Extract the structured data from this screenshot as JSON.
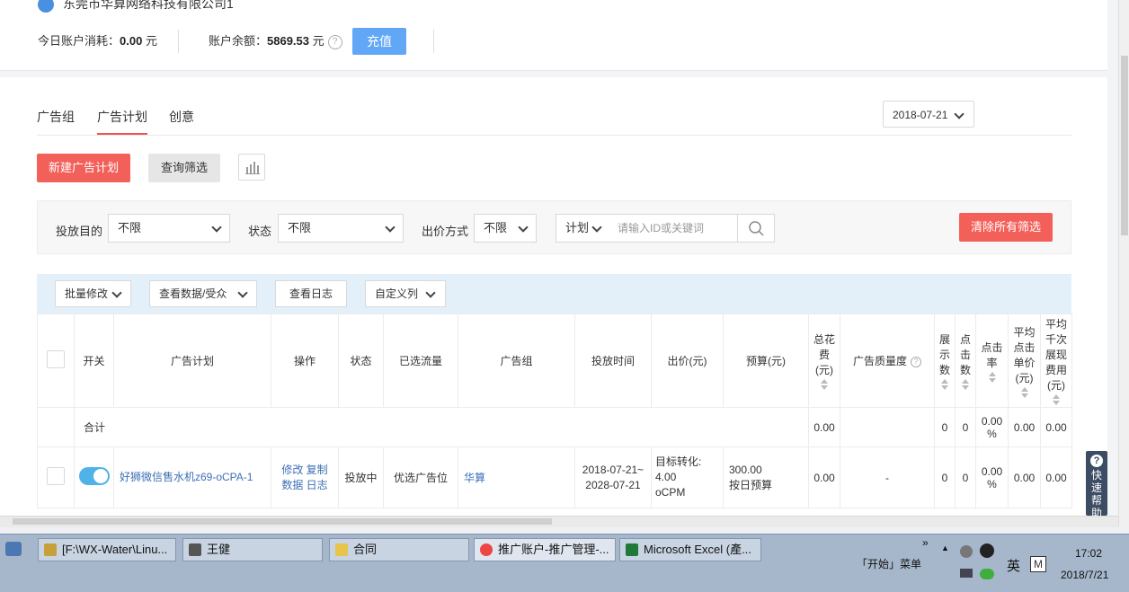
{
  "header": {
    "company": "东莞市华算网络科技有限公司1",
    "today_spend_label": "今日账户消耗：",
    "today_spend_value": "0.00",
    "currency": "元",
    "balance_label": "账户余额：",
    "balance_value": "5869.53",
    "help": "?",
    "recharge": "充值"
  },
  "tabs": [
    {
      "label": "广告组"
    },
    {
      "label": "广告计划",
      "active": true
    },
    {
      "label": "创意"
    }
  ],
  "date": "2018-07-21",
  "actions": {
    "new_plan": "新建广告计划",
    "query_filter": "查询筛选"
  },
  "filters": {
    "purpose_label": "投放目的",
    "purpose_value": "不限",
    "status_label": "状态",
    "status_value": "不限",
    "bid_label": "出价方式",
    "bid_value": "不限",
    "search_scope": "计划",
    "search_placeholder": "请输入ID或关键词",
    "clear_all": "清除所有筛选"
  },
  "toolbar": {
    "batch_edit": "批量修改",
    "view_data": "查看数据/受众",
    "view_log": "查看日志",
    "custom_columns": "自定义列"
  },
  "table": {
    "columns": [
      "开关",
      "广告计划",
      "操作",
      "状态",
      "已选流量",
      "广告组",
      "投放时间",
      "出价(元)",
      "预算(元)",
      "总花费(元)",
      "广告质量度",
      "展示数",
      "点击数",
      "点击率",
      "平均点击单价(元)",
      "平均千次展现费用(元)"
    ],
    "total_row": {
      "label": "合计",
      "cost": "0.00",
      "impressions": "0",
      "clicks": "0",
      "ctr": "0.00 %",
      "cpc": "0.00",
      "cpm": "0.00"
    },
    "rows": [
      {
        "name": "好狮微信售水机z69-oCPA-1",
        "op_edit": "修改",
        "op_copy": "复制",
        "op_data": "数据",
        "op_log": "日志",
        "status": "投放中",
        "traffic": "优选广告位",
        "group": "华算",
        "time_start": "2018-07-21~",
        "time_end": "2028-07-21",
        "bid_line1": "目标转化:",
        "bid_line2": "4.00",
        "bid_line3": "oCPM",
        "budget": "300.00",
        "budget_type": "按日预算",
        "cost": "0.00",
        "quality": "-",
        "impressions": "0",
        "clicks": "0",
        "ctr": "0.00 %",
        "cpc": "0.00",
        "cpm": "0.00"
      }
    ]
  },
  "quick_help": "快速帮助",
  "taskbar": {
    "tasks": [
      "[F:\\WX-Water\\Linu...",
      "王健",
      "合同",
      "推广账户-推广管理-...",
      "Microsoft Excel (產..."
    ],
    "start_menu": "「开始」菜单",
    "ime": "英",
    "time": "17:02",
    "date": "2018/7/21"
  }
}
